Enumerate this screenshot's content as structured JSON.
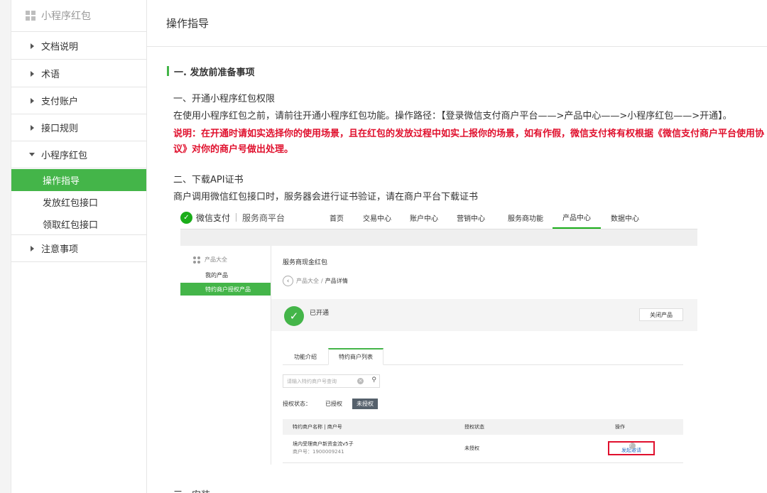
{
  "sidebar": {
    "header_title": "小程序红包",
    "items": [
      {
        "label": "文档说明"
      },
      {
        "label": "术语"
      },
      {
        "label": "支付账户"
      },
      {
        "label": "接口规则"
      },
      {
        "label": "小程序红包"
      },
      {
        "label": "注意事项"
      }
    ],
    "subitems": [
      {
        "label": "操作指导",
        "active": true
      },
      {
        "label": "发放红包接口"
      },
      {
        "label": "领取红包接口"
      }
    ]
  },
  "main": {
    "header_title": "操作指导",
    "section_title": "一. 发放前准备事项",
    "p1_heading": "一、开通小程序红包权限",
    "p1_text": "在使用小程序红包之前，请前往开通小程序红包功能。操作路径：【登录微信支付商户平台——>产品中心——>小程序红包——>开通】。",
    "notice_line1": "说明：在开通时请如实选择你的使用场景，且在红包的发放过程中如实上报你的场景，如有作假，微信支付将有权根据《微信支付商户平台使用协",
    "notice_line2": "议》对你的商户号做出处理。",
    "p2_heading": "二、下载API证书",
    "p2_text": "商户调用微信红包接口时，服务器会进行证书验证，请在商户平台下载证书",
    "next_heading_partial": "三、安装"
  },
  "embedded": {
    "logo_text": "微信支付",
    "logo_sub": "服务商平台",
    "nav": [
      "首页",
      "交易中心",
      "账户中心",
      "营销中心",
      "服务商功能",
      "产品中心",
      "数据中心"
    ],
    "nav_active": "产品中心",
    "left_head": "产品大全",
    "left_items": [
      "我的产品",
      "特约商户授权产品"
    ],
    "page_title": "服务商现金红包",
    "crumb_parent": "产品大全",
    "crumb_sep": "/",
    "crumb_current": "产品详情",
    "status_text": "已开通",
    "close_button": "关闭产品",
    "tabs": [
      "功能介绍",
      "特约商户列表"
    ],
    "search_placeholder": "请输入特约商户号查询",
    "filter_label": "授权状态：",
    "filter_options": [
      "已授权",
      "未授权"
    ],
    "table_headers": [
      "特约商户名称 | 商户号",
      "授权状态",
      "操作"
    ],
    "row": {
      "name": "境内受理商户新资金流v5子",
      "merchant_no": "商户号：1900009241",
      "status": "未授权",
      "action": "发起邀请"
    }
  },
  "colors": {
    "accent_green": "#44b549",
    "wechat_green": "#1aad19",
    "notice_red": "#e0102d",
    "link_blue": "#2a6cc4"
  }
}
